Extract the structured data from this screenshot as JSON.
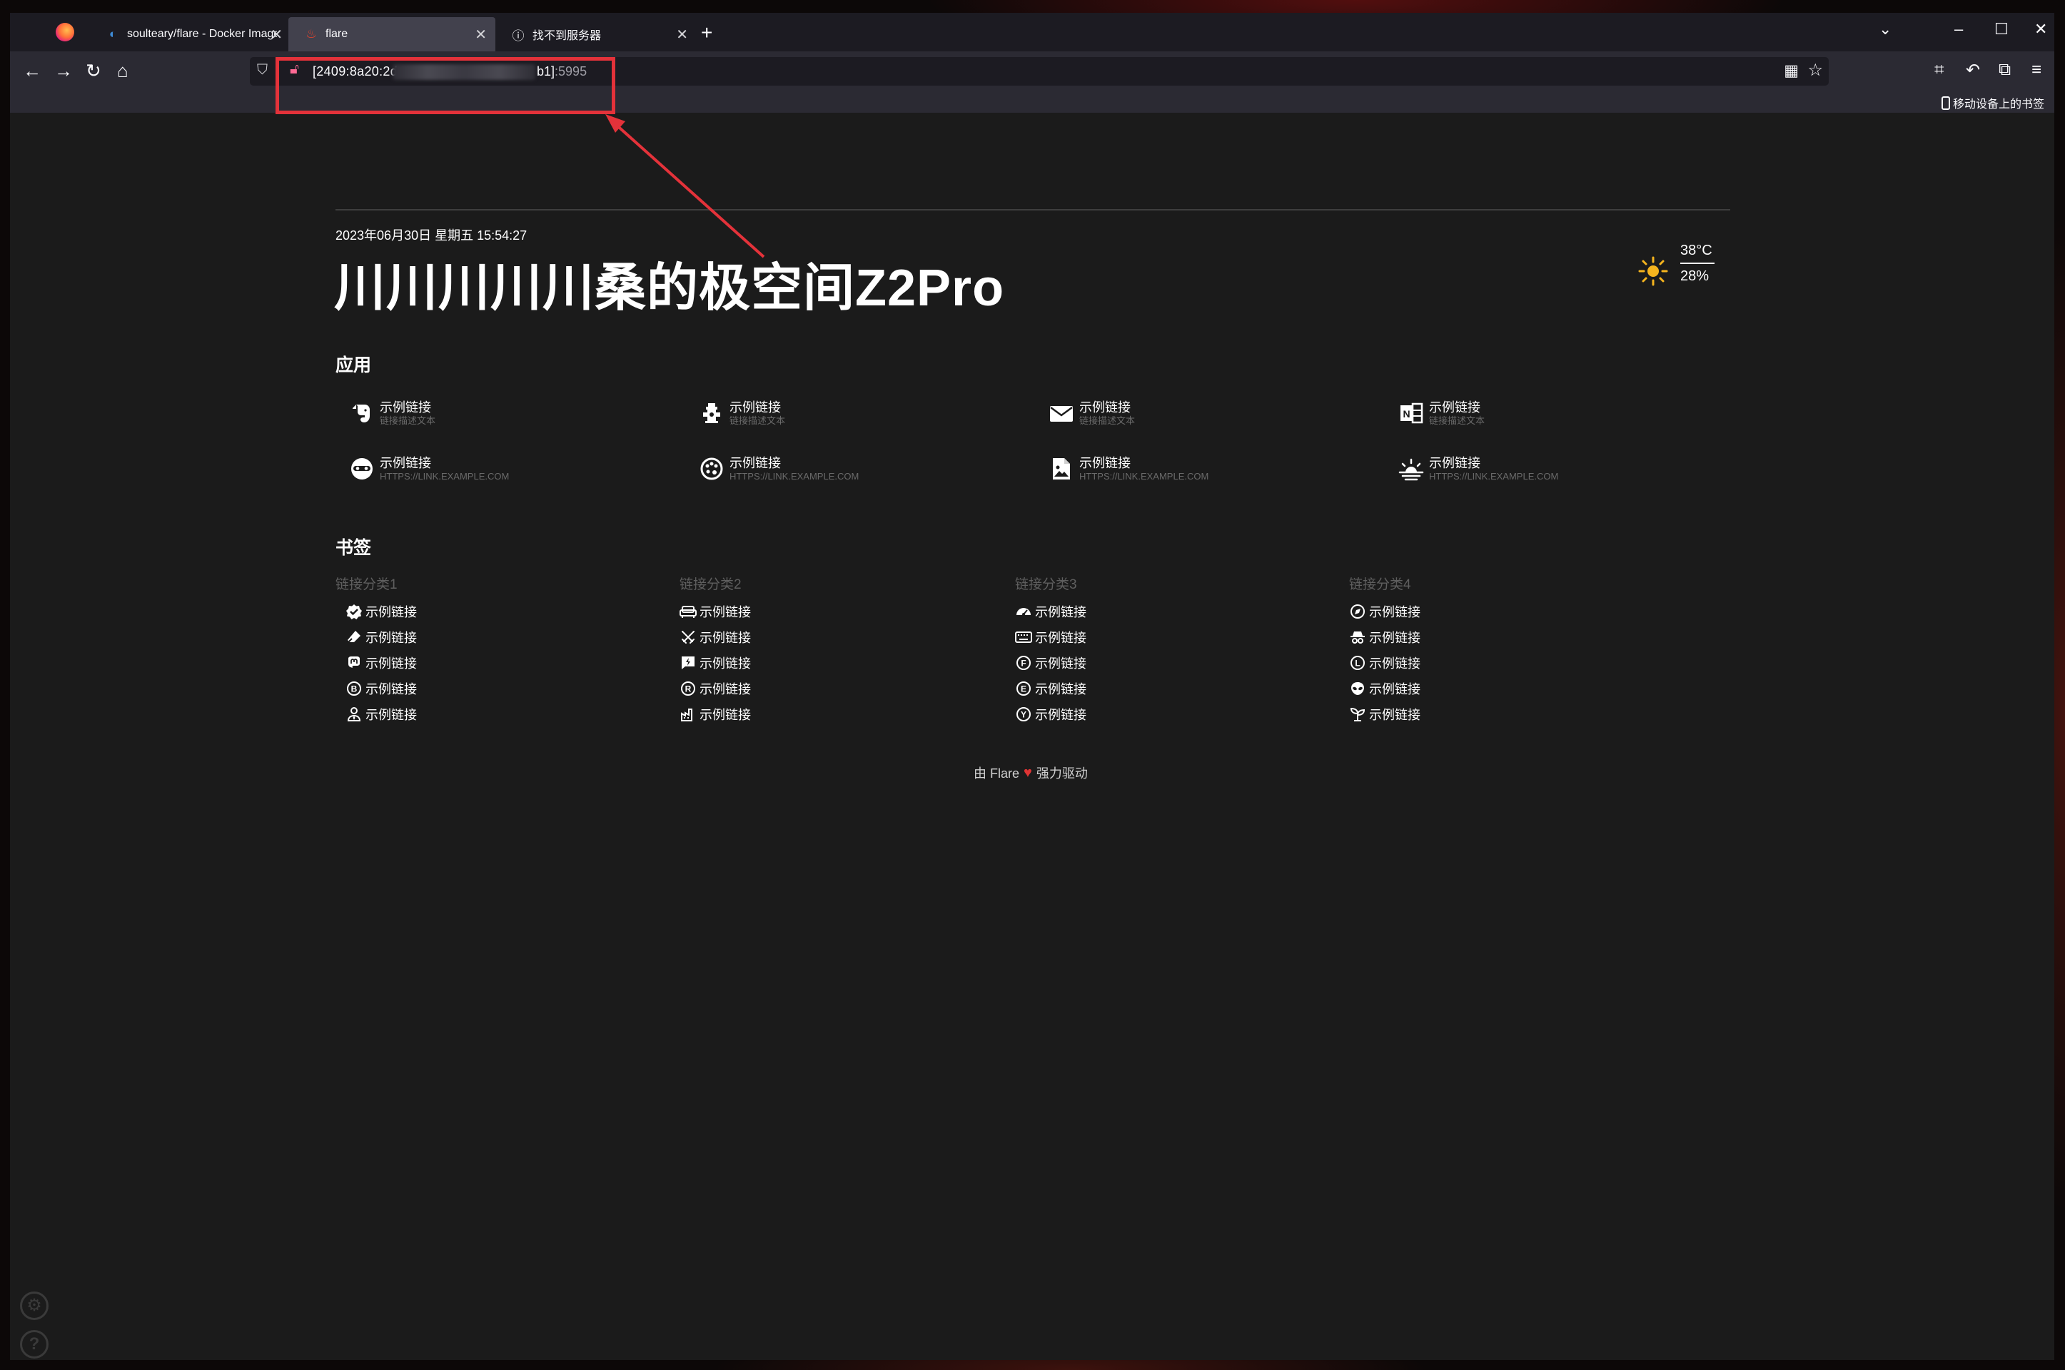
{
  "browser": {
    "tabs": [
      {
        "label": "soulteary/flare - Docker Image",
        "icon": "docker-icon"
      },
      {
        "label": "flare",
        "icon": "flame-icon"
      },
      {
        "label": "找不到服务器",
        "icon": "info-icon"
      }
    ],
    "url": {
      "prefix": "[2409:8a20:2d",
      "suffix": "b1]",
      "port": ":5995"
    },
    "mobile_bookmarks": "移动设备上的书签",
    "colors": {
      "tab_active": "#42414d",
      "url_highlight": "#e4323a"
    }
  },
  "page": {
    "datetime": "2023年06月30日 星期五 15:54:27",
    "greeting": "川川川川川桑的极空间Z2Pro",
    "weather": {
      "temperature": "38°C",
      "humidity": "28%",
      "icon": "sun-icon"
    },
    "apps_title": "应用",
    "apps": [
      {
        "name": "示例链接",
        "desc": "链接描述文本",
        "icon": "evernote-icon"
      },
      {
        "name": "示例链接",
        "desc": "链接描述文本",
        "icon": "fire-hydrant-icon"
      },
      {
        "name": "示例链接",
        "desc": "链接描述文本",
        "icon": "mail-icon"
      },
      {
        "name": "示例链接",
        "desc": "链接描述文本",
        "icon": "onenote-icon"
      },
      {
        "name": "示例链接",
        "desc": "HTTPS://LINK.EXAMPLE.COM",
        "icon": "incognito-icon"
      },
      {
        "name": "示例链接",
        "desc": "HTTPS://LINK.EXAMPLE.COM",
        "icon": "palette-icon"
      },
      {
        "name": "示例链接",
        "desc": "HTTPS://LINK.EXAMPLE.COM",
        "icon": "file-image-icon"
      },
      {
        "name": "示例链接",
        "desc": "HTTPS://LINK.EXAMPLE.COM",
        "icon": "sunset-icon"
      }
    ],
    "bookmarks_title": "书签",
    "bookmark_groups": [
      {
        "category": "链接分类1",
        "items": [
          {
            "label": "示例链接",
            "icon": "check-decagram-icon"
          },
          {
            "label": "示例链接",
            "icon": "eraser-icon"
          },
          {
            "label": "示例链接",
            "icon": "mastodon-icon"
          },
          {
            "label": "示例链接",
            "icon": "circle-letter-b-icon"
          },
          {
            "label": "示例链接",
            "icon": "account-tie-icon"
          }
        ]
      },
      {
        "category": "链接分类2",
        "items": [
          {
            "label": "示例链接",
            "icon": "sofa-icon"
          },
          {
            "label": "示例链接",
            "icon": "sword-cross-icon"
          },
          {
            "label": "示例链接",
            "icon": "message-flash-icon"
          },
          {
            "label": "示例链接",
            "icon": "circle-letter-r-icon"
          },
          {
            "label": "示例链接",
            "icon": "factory-icon"
          }
        ]
      },
      {
        "category": "链接分类3",
        "items": [
          {
            "label": "示例链接",
            "icon": "speedometer-icon"
          },
          {
            "label": "示例链接",
            "icon": "keyboard-icon"
          },
          {
            "label": "示例链接",
            "icon": "circle-letter-f-icon"
          },
          {
            "label": "示例链接",
            "icon": "circle-letter-e-icon"
          },
          {
            "label": "示例链接",
            "icon": "circle-letter-y-icon"
          }
        ]
      },
      {
        "category": "链接分类4",
        "items": [
          {
            "label": "示例链接",
            "icon": "compass-icon"
          },
          {
            "label": "示例链接",
            "icon": "spy-icon"
          },
          {
            "label": "示例链接",
            "icon": "circle-letter-l-icon"
          },
          {
            "label": "示例链接",
            "icon": "alien-icon"
          },
          {
            "label": "示例链接",
            "icon": "seedling-icon"
          }
        ]
      }
    ],
    "footer": {
      "prefix": "由 Flare",
      "suffix": "强力驱动"
    }
  }
}
